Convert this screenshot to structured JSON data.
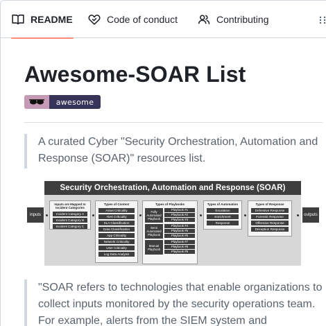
{
  "tabs": [
    {
      "label": "README",
      "icon": "book-icon",
      "active": true
    },
    {
      "label": "Code of conduct",
      "icon": "heart-handshake-icon",
      "active": false
    },
    {
      "label": "Contributing",
      "icon": "people-icon",
      "active": false
    }
  ],
  "readme": {
    "title": "Awesome-SOAR List",
    "badge": {
      "text": "awesome",
      "left_color": "#c49ab4",
      "right_color": "#363458"
    },
    "intro": "A curated Cyber \"Security Orchestration, Automation and Response (SOAR)\" resources list.",
    "quote": "\"SOAR refers to technologies that enable organizations to collect inputs monitored by the security operations team. For example, alerts from the SIEM system and"
  },
  "diagram": {
    "title": "Security Orchestration, Automation and Response (SOAR)",
    "inputs_label": "inputs",
    "outputs_label": "outputs",
    "columns": [
      {
        "header": "Inputs are Mapped to Incident Categories",
        "items": [
          "Incident Category A",
          "Incident Category B",
          "Incident Category C"
        ]
      },
      {
        "header": "Types of Context",
        "items": [
          "Asset Criticality",
          "Alert Criticality",
          "SLA Classification",
          "Data Classification",
          "App Criticality",
          "Network Criticality",
          "User Criticality",
          "Log Data Analysis"
        ]
      },
      {
        "header": "Types of Playbooks",
        "groups": [
          {
            "label": "Fully Automated Playbook",
            "items": [
              "Playbook #1",
              "Playbook #2",
              "Playbook #3"
            ]
          },
          {
            "label": "Semi Automated Playbook",
            "items": [
              "Playbook #4",
              "Playbook #5",
              "Playbook #6"
            ]
          },
          {
            "label": "Manual Playbook",
            "items": [
              "Playbook #7",
              "Playbook #8",
              "Playbook #9"
            ]
          }
        ]
      },
      {
        "header": "Types of Automation",
        "items": [
          "Escalation",
          "Enrichment",
          "Response"
        ]
      },
      {
        "header": "Types of Response",
        "items": [
          "Defensive Response",
          "Forensic Response",
          "Offensive Response",
          "Deception Response"
        ]
      }
    ]
  },
  "colors": {
    "accent_underline": "#fd8c73",
    "border": "#d0d7de",
    "muted_text": "#59636e"
  }
}
